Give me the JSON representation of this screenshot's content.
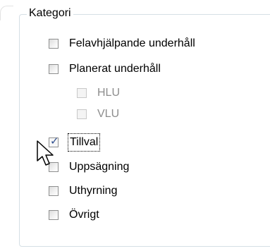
{
  "group": {
    "legend": "Kategori"
  },
  "options": [
    {
      "label": "Felavhjälpande underhåll",
      "checked": false,
      "enabled": true
    },
    {
      "label": "Planerat underhåll",
      "checked": false,
      "enabled": true
    },
    {
      "label": "HLU",
      "checked": false,
      "enabled": false
    },
    {
      "label": "VLU",
      "checked": false,
      "enabled": false
    },
    {
      "label": "Tillval",
      "checked": true,
      "enabled": true
    },
    {
      "label": "Uppsägning",
      "checked": false,
      "enabled": true
    },
    {
      "label": "Uthyrning",
      "checked": false,
      "enabled": true
    },
    {
      "label": "Övrigt",
      "checked": false,
      "enabled": true
    }
  ],
  "cursor": {
    "icon": "arrow-cursor-icon"
  }
}
